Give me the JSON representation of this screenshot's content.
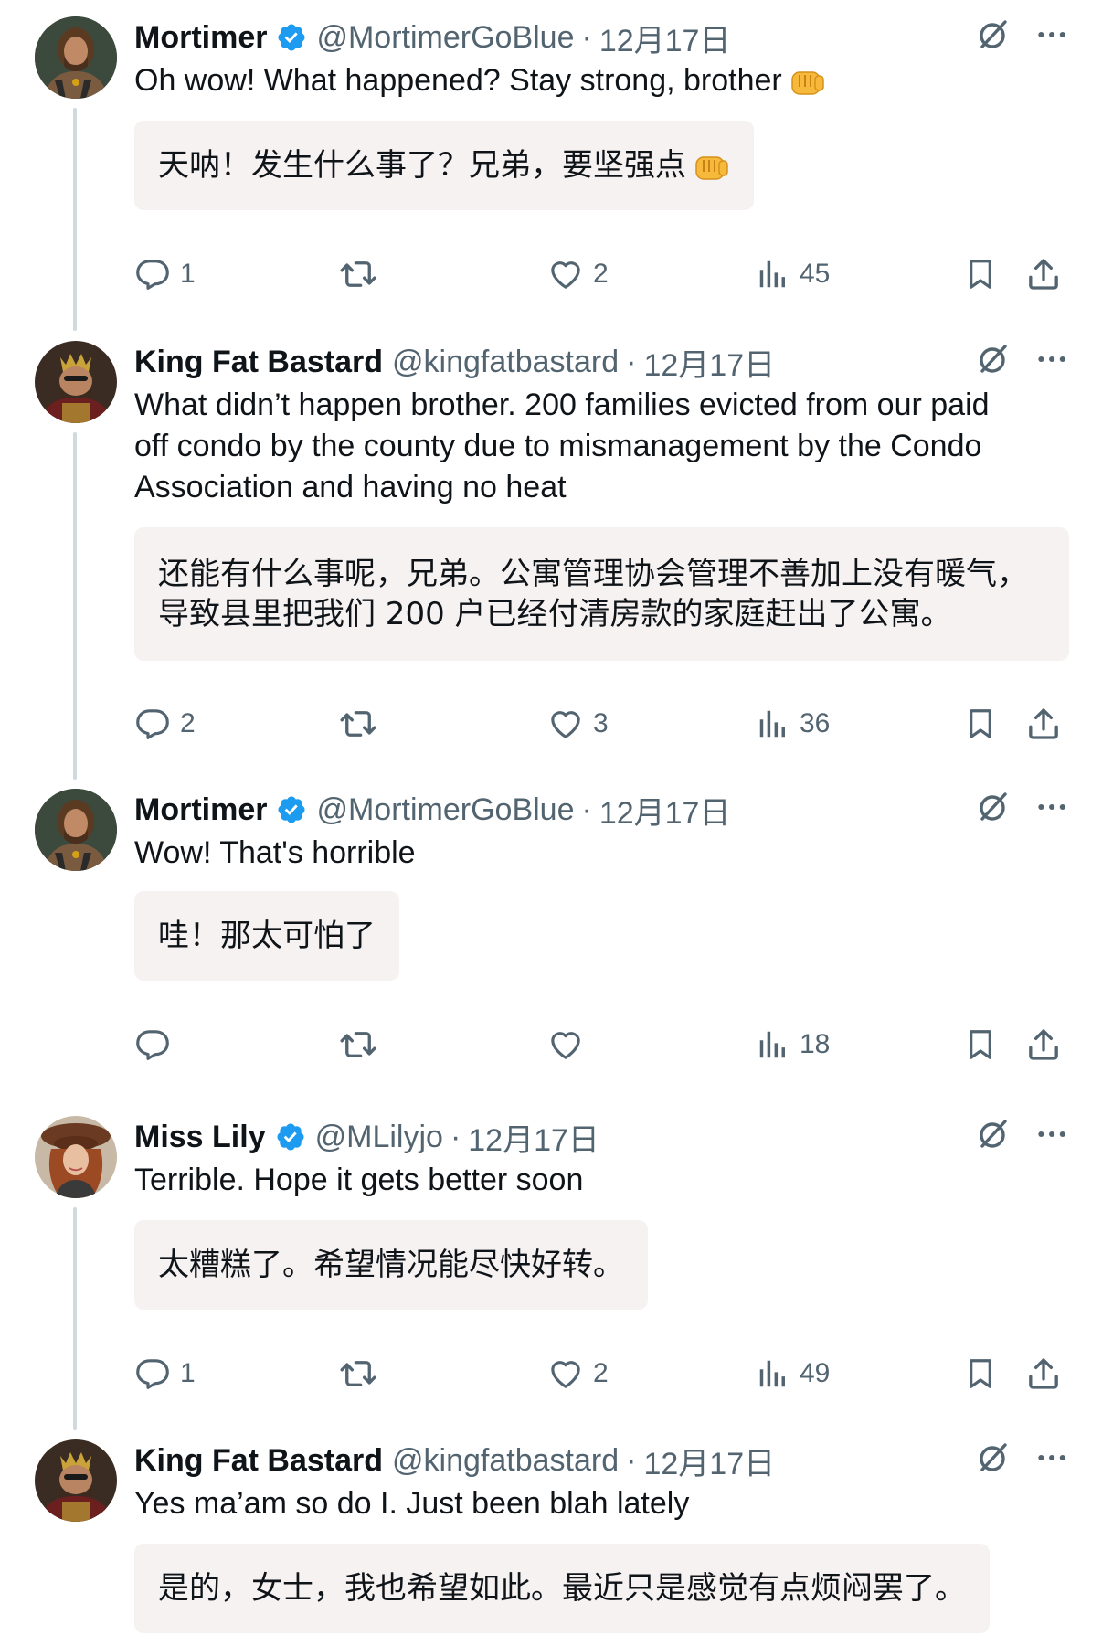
{
  "tweets": [
    {
      "name": "Mortimer",
      "verified": true,
      "handle": "@MortimerGoBlue",
      "sep": "·",
      "date": "12月17日",
      "text": "Oh wow! What happened?  Stay strong, brother",
      "emoji": "oncoming-fist",
      "translation": "天呐！发生什么事了？兄弟，要坚强点",
      "replies": "1",
      "retweets": "",
      "likes": "2",
      "views": "45"
    },
    {
      "name": "King Fat Bastard",
      "verified": false,
      "handle": "@kingfatbastard",
      "sep": "·",
      "date": "12月17日",
      "text_lines": [
        "What didn’t happen brother. 200 families evicted from our paid",
        "off condo by the county due to mismanagement by the Condo",
        "Association and having no heat"
      ],
      "translation_lines": [
        "还能有什么事呢，兄弟。公寓管理协会管理不善加上没有暖气，",
        "导致县里把我们 200 户已经付清房款的家庭赶出了公寓。"
      ],
      "replies": "2",
      "retweets": "",
      "likes": "3",
      "views": "36"
    },
    {
      "name": "Mortimer",
      "verified": true,
      "handle": "@MortimerGoBlue",
      "sep": "·",
      "date": "12月17日",
      "text": "Wow! That's horrible",
      "translation": "哇！那太可怕了",
      "replies": "",
      "retweets": "",
      "likes": "",
      "views": "18"
    },
    {
      "name": "Miss Lily",
      "verified": true,
      "handle": "@MLilyjo",
      "sep": "·",
      "date": "12月17日",
      "text": "Terrible. Hope it gets better soon",
      "translation": "太糟糕了。希望情况能尽快好转。",
      "replies": "1",
      "retweets": "",
      "likes": "2",
      "views": "49"
    },
    {
      "name": "King Fat Bastard",
      "verified": false,
      "handle": "@kingfatbastard",
      "sep": "·",
      "date": "12月17日",
      "text": "Yes ma’am so do I. Just been blah lately",
      "translation": "是的，女士，我也希望如此。最近只是感觉有点烦闷罢了。"
    }
  ],
  "icons": {
    "verified": "verified-badge-icon",
    "grok": "grok-icon",
    "more": "more-icon",
    "reply": "reply-icon",
    "retweet": "retweet-icon",
    "like": "like-icon",
    "views": "views-icon",
    "bookmark": "bookmark-icon",
    "share": "share-icon"
  },
  "colors": {
    "verified": "#1d9bf0",
    "text": "#0f1419",
    "secondary": "#536471",
    "thread_line": "#cfd9de",
    "translation_bg": "#f7f2f2"
  }
}
